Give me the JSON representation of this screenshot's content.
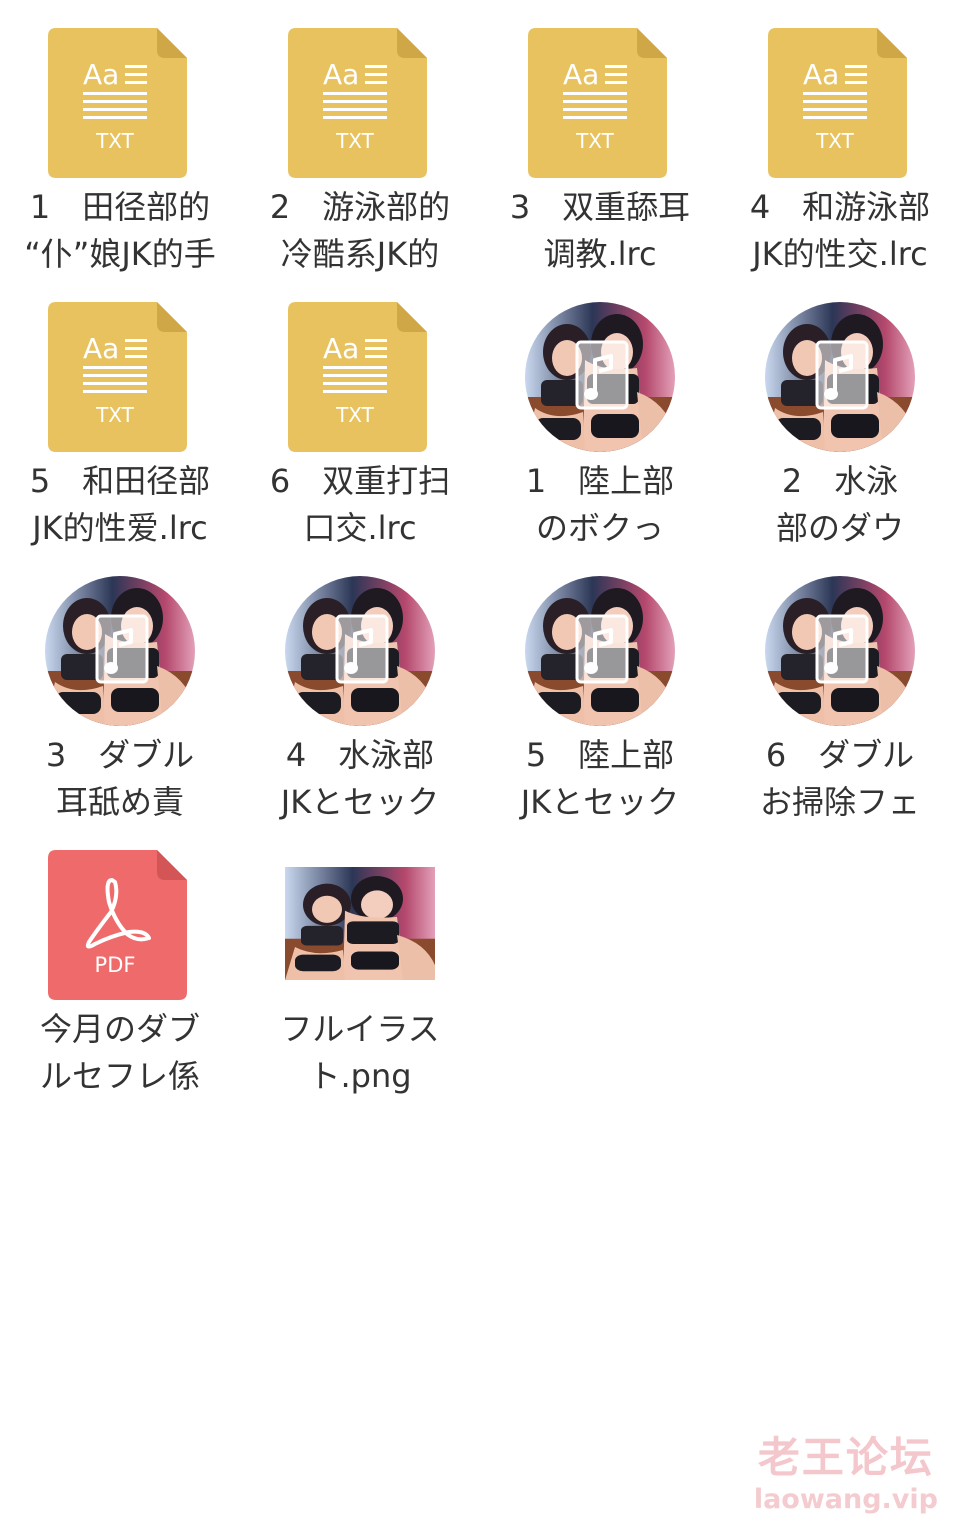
{
  "files": [
    {
      "type": "txt",
      "icon_text": "TXT",
      "icon_glyph": "Aa",
      "lines": [
        "1　田径部的",
        "“仆”娘JK的手"
      ]
    },
    {
      "type": "txt",
      "icon_text": "TXT",
      "icon_glyph": "Aa",
      "lines": [
        "2　游泳部的",
        "冷酷系JK的"
      ]
    },
    {
      "type": "txt",
      "icon_text": "TXT",
      "icon_glyph": "Aa",
      "lines": [
        "3　双重舔耳",
        "调教.lrc"
      ]
    },
    {
      "type": "txt",
      "icon_text": "TXT",
      "icon_glyph": "Aa",
      "lines": [
        "4　和游泳部",
        "JK的性交.lrc"
      ]
    },
    {
      "type": "txt",
      "icon_text": "TXT",
      "icon_glyph": "Aa",
      "lines": [
        "5　和田径部",
        "JK的性爱.lrc"
      ]
    },
    {
      "type": "txt",
      "icon_text": "TXT",
      "icon_glyph": "Aa",
      "lines": [
        "6　双重打扫",
        "口交.lrc"
      ]
    },
    {
      "type": "audio",
      "icon": "music-note-icon",
      "lines": [
        "1　陸上部",
        "のボクっ"
      ]
    },
    {
      "type": "audio",
      "icon": "music-note-icon",
      "lines": [
        "2　水泳",
        "部のダウ"
      ]
    },
    {
      "type": "audio",
      "icon": "music-note-icon",
      "lines": [
        "3　ダブル",
        "耳舐め責"
      ]
    },
    {
      "type": "audio",
      "icon": "music-note-icon",
      "lines": [
        "4　水泳部",
        "JKとセック"
      ]
    },
    {
      "type": "audio",
      "icon": "music-note-icon",
      "lines": [
        "5　陸上部",
        "JKとセック"
      ]
    },
    {
      "type": "audio",
      "icon": "music-note-icon",
      "lines": [
        "6　ダブル",
        "お掃除フェ"
      ]
    },
    {
      "type": "pdf",
      "icon_text": "PDF",
      "icon": "acrobat-icon",
      "lines": [
        "今月のダブ",
        "ルセフレ係"
      ]
    },
    {
      "type": "image",
      "icon": "image-thumbnail",
      "lines": [
        "フルイラス",
        "ト.png"
      ]
    }
  ],
  "watermark": {
    "title": "老王论坛",
    "url": "laowang.vip"
  },
  "colors": {
    "txt": "#e8c25e",
    "pdf": "#ef6b6b",
    "label": "#333333",
    "watermark": "#f3c7cc"
  }
}
